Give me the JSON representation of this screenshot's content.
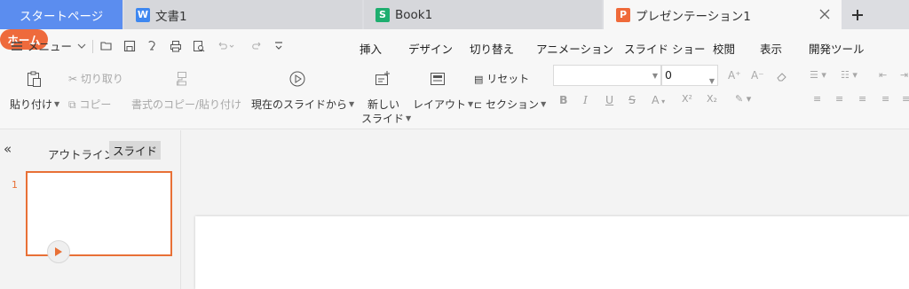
{
  "tabs": {
    "start": "スタートページ",
    "doc": {
      "label": "文書1",
      "badge": "W"
    },
    "book": {
      "label": "Book1",
      "badge": "S"
    },
    "ppt": {
      "label": "プレゼンテーション1",
      "badge": "P"
    },
    "close_icon": "close-icon",
    "new_tab_icon": "plus-icon"
  },
  "menu": {
    "label": "メニュー",
    "ribbon_tabs": [
      "ホーム",
      "挿入",
      "デザイン",
      "切り替え",
      "アニメーション",
      "スライド ショー",
      "校閲",
      "表示",
      "開発ツール"
    ]
  },
  "ribbon": {
    "paste": "貼り付け",
    "cut": "切り取り",
    "copy": "コピー",
    "format_painter": "書式のコピー/貼り付け",
    "from_current": "現在のスライドから",
    "new_slide_1": "新しい",
    "new_slide_2": "スライド",
    "layout": "レイアウト",
    "reset": "リセット",
    "section": "セクション",
    "font_name": "",
    "font_size": "0"
  },
  "panel": {
    "outline": "アウトライン",
    "slides": "スライド",
    "slide_number": "1"
  },
  "colors": {
    "accent": "#ee6a3c",
    "start_tab": "#5b8def",
    "writer": "#3e87f0",
    "spreadsheet": "#1eae6f"
  }
}
